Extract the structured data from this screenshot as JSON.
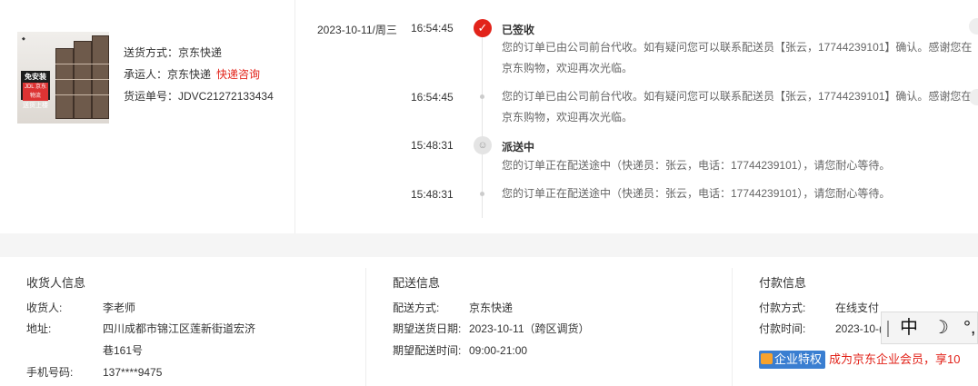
{
  "shipping_summary": {
    "product_badge_main": "免安装",
    "product_badge_sub": "JDL 京东物流",
    "product_badge_tag": "送货上楼",
    "method": "送货方式：京东快递",
    "carrier_label": "承运人：京东快递",
    "carrier_link": "快递咨询",
    "tracking": "货运单号：JDVC21272133434"
  },
  "timeline": {
    "date": "2023-10-11/周三",
    "entries": [
      {
        "time": "16:54:45",
        "status": "已签收",
        "desc": "您的订单已由公司前台代收。如有疑问您可以联系配送员【张云，17744239101】确认。感谢您在京东购物，欢迎再次光临。"
      },
      {
        "time": "16:54:45",
        "status": "",
        "desc": "您的订单已由公司前台代收。如有疑问您可以联系配送员【张云，17744239101】确认。感谢您在京东购物，欢迎再次光临。"
      },
      {
        "time": "15:48:31",
        "status": "派送中",
        "desc": "您的订单正在配送途中（快递员：张云，电话：17744239101），请您耐心等待。"
      },
      {
        "time": "15:48:31",
        "status": "",
        "desc": "您的订单正在配送途中（快递员：张云，电话：17744239101），请您耐心等待。"
      }
    ]
  },
  "receiver": {
    "title": "收货人信息",
    "name_label": "收货人:",
    "name": "李老师",
    "address_label": "地址:",
    "address_line1": "四川成都市锦江区莲新街道宏济",
    "address_line2": "巷161号",
    "phone_label": "手机号码:",
    "phone": "137****9475"
  },
  "delivery": {
    "title": "配送信息",
    "method_label": "配送方式:",
    "method": "京东快递",
    "date_label": "期望送货日期:",
    "date": "2023-10-11（跨区调货）",
    "time_label": "期望配送时间:",
    "time": "09:00-21:00"
  },
  "payment": {
    "title": "付款信息",
    "method_label": "付款方式:",
    "method": "在线支付",
    "time_label": "付款时间:",
    "time": "2023-10-(",
    "enterprise_badge": "企业特权",
    "enterprise_text": "成为京东企业会员，享10"
  },
  "ime_toolbar": {
    "lang": "中",
    "moon": "☽",
    "punct": "°,"
  },
  "colors": {
    "accent": "#e2231a",
    "enterprise_blue": "#3a7ed1"
  }
}
